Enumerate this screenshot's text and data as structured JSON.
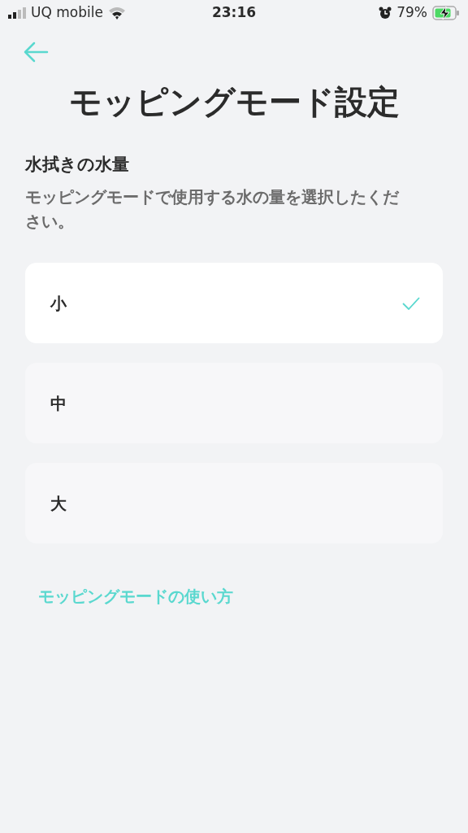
{
  "status_bar": {
    "carrier": "UQ mobile",
    "time": "23:16",
    "battery": "79%"
  },
  "title": "モッピングモード設定",
  "section": {
    "heading": "水拭きの水量",
    "description": "モッピングモードで使用する水の量を選択したください。"
  },
  "options": [
    {
      "label": "小",
      "selected": true
    },
    {
      "label": "中",
      "selected": false
    },
    {
      "label": "大",
      "selected": false
    }
  ],
  "help_link": "モッピングモードの使い方"
}
